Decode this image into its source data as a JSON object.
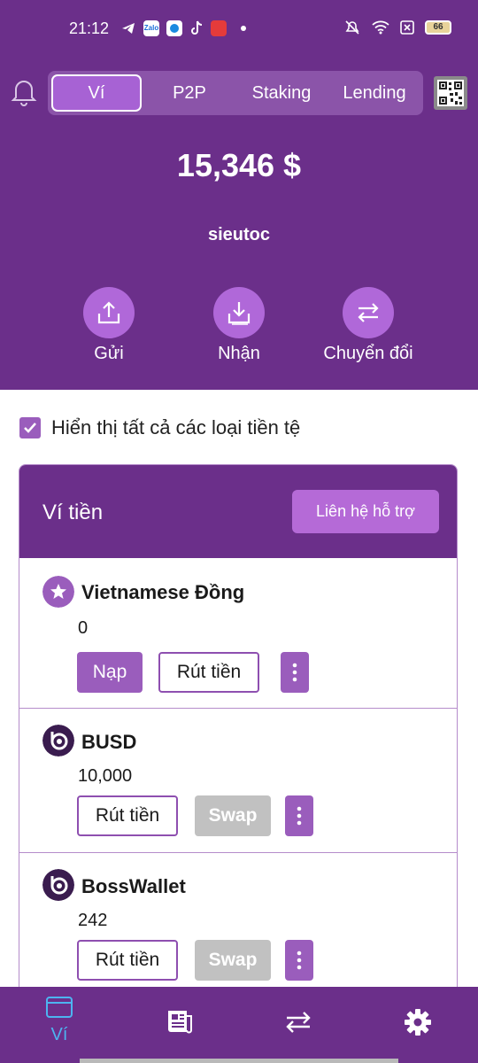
{
  "status_bar": {
    "time": "21:12",
    "battery": "66"
  },
  "tabs": [
    "Ví",
    "P2P",
    "Staking",
    "Lending"
  ],
  "balance": "15,346 $",
  "username": "sieutoc",
  "actions": {
    "send": "Gửi",
    "receive": "Nhận",
    "convert": "Chuyển đổi"
  },
  "show_all_label": "Hiển thị tất cả các loại tiền tệ",
  "wallet": {
    "title": "Ví tiền",
    "support_button": "Liên hệ hỗ trợ",
    "coins": [
      {
        "name": "Vietnamese Đồng",
        "amount": "0",
        "primary": "Nạp",
        "secondary": "Rút tiền"
      },
      {
        "name": "BUSD",
        "amount": "10,000",
        "primary": "Rút tiền",
        "secondary": "Swap"
      },
      {
        "name": "BossWallet",
        "amount": "242",
        "primary": "Rút tiền",
        "secondary": "Swap"
      }
    ]
  },
  "bottom_nav": {
    "wallet_label": "Ví"
  },
  "colors": {
    "primary": "#6b2f8a",
    "accent": "#b068d9",
    "nav_active": "#4db4f0"
  }
}
